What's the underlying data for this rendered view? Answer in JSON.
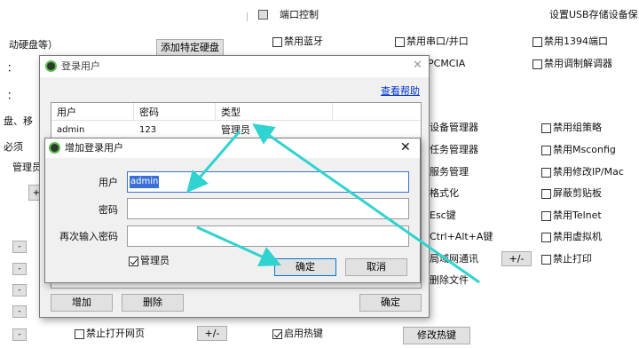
{
  "background": {
    "port_icon_label": "端口控制",
    "usb_setting": "设置USB存储设备保",
    "mobile_disk": "动硬盘等）",
    "add_disk_btn": "添加特定硬盘",
    "checks_row1": [
      "禁用蓝牙",
      "禁用串口/并口",
      "禁用1394端口"
    ],
    "pcmcia": "PCMCIA",
    "modem": "禁用调制解调器",
    "left_fragments": [
      "：",
      "：",
      "盘、移",
      "必须",
      "管理员"
    ],
    "mid_items": [
      "设备管理器",
      "任务管理器",
      "服务管理",
      "格式化",
      "Esc键",
      "Ctrl+Alt+A键",
      "局域网通讯",
      "删除文件"
    ],
    "right_items": [
      "禁用组策略",
      "禁用Msconfig",
      "禁用修改IP/Mac",
      "屏蔽剪贴板",
      "禁用Telnet",
      "禁用虚拟机",
      "禁止打印"
    ],
    "plus_minus": "+/-",
    "bottom_check_web": "禁止打开网页",
    "bottom_check_hotkey": "启用热键",
    "modify_hotkey_btn": "修改热键"
  },
  "login_dialog": {
    "title": "登录用户",
    "help_link": "查看帮助",
    "columns": [
      "用户",
      "密码",
      "类型"
    ],
    "rows": [
      {
        "user": "admin",
        "password": "123",
        "type": "管理员"
      }
    ],
    "add_btn": "增加",
    "delete_btn": "删除",
    "ok_btn": "确定"
  },
  "add_dialog": {
    "title": "增加登录用户",
    "user_label": "用户",
    "user_value": "admin",
    "password_label": "密码",
    "password_value": "",
    "confirm_label": "再次输入密码",
    "confirm_value": "",
    "admin_checkbox": "管理员",
    "admin_checked": true,
    "ok_btn": "确定",
    "cancel_btn": "取消"
  },
  "colors": {
    "arrow": "#2fd3cf",
    "selection": "#3a6fd8",
    "link": "#0033cc"
  }
}
